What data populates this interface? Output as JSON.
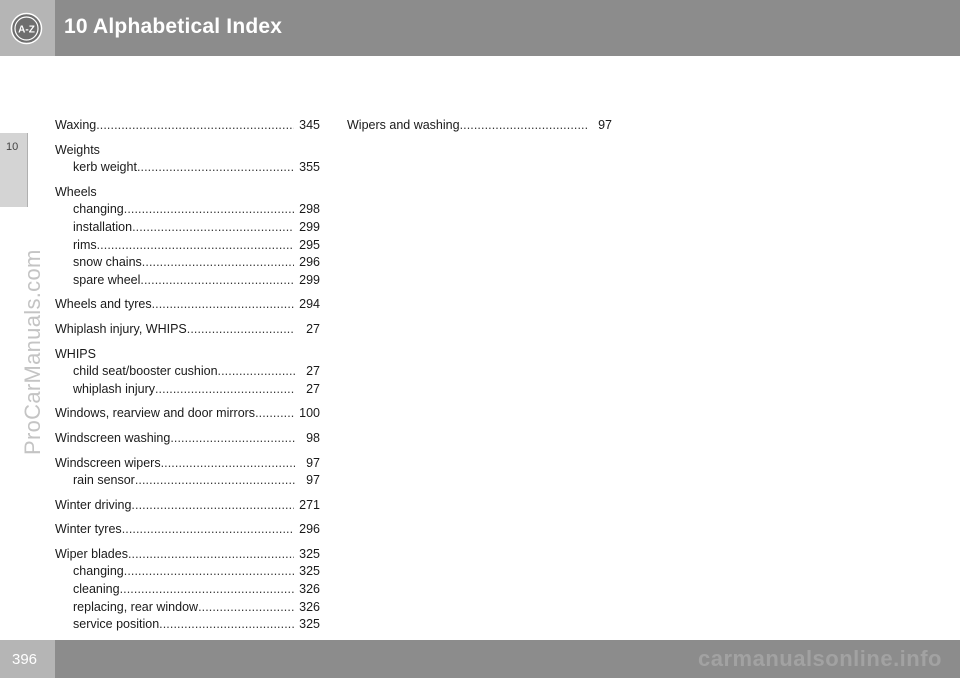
{
  "header": {
    "icon_label": "A-Z",
    "title": "10 Alphabetical Index"
  },
  "chapter_tab": "10",
  "side_watermark": "ProCarManuals.com",
  "footer": {
    "page_number": "396",
    "watermark": "carmanualsonline.info"
  },
  "index": {
    "left": [
      {
        "term": "Waxing",
        "page": "345",
        "subs": []
      },
      {
        "term": "Weights",
        "page": "",
        "subs": [
          {
            "term": "kerb weight",
            "page": "355"
          }
        ]
      },
      {
        "term": "Wheels",
        "page": "",
        "subs": [
          {
            "term": "changing",
            "page": "298"
          },
          {
            "term": "installation",
            "page": "299"
          },
          {
            "term": "rims",
            "page": "295"
          },
          {
            "term": "snow chains",
            "page": "296"
          },
          {
            "term": "spare wheel",
            "page": "299"
          }
        ]
      },
      {
        "term": "Wheels and tyres",
        "page": "294",
        "subs": []
      },
      {
        "term": "Whiplash injury, WHIPS",
        "page": "27",
        "subs": []
      },
      {
        "term": "WHIPS",
        "page": "",
        "subs": [
          {
            "term": "child seat/booster cushion",
            "page": "27"
          },
          {
            "term": "whiplash injury",
            "page": "27"
          }
        ]
      },
      {
        "term": "Windows, rearview and door mirrors",
        "page": "100",
        "subs": []
      },
      {
        "term": "Windscreen washing",
        "page": "98",
        "subs": []
      },
      {
        "term": "Windscreen wipers",
        "page": "97",
        "subs": [
          {
            "term": "rain sensor",
            "page": "97"
          }
        ]
      },
      {
        "term": "Winter driving",
        "page": "271",
        "subs": []
      },
      {
        "term": "Winter tyres",
        "page": "296",
        "subs": []
      },
      {
        "term": "Wiper blades",
        "page": "325",
        "subs": [
          {
            "term": "changing",
            "page": "325"
          },
          {
            "term": "cleaning",
            "page": "326"
          },
          {
            "term": "replacing, rear window",
            "page": "326"
          },
          {
            "term": "service position",
            "page": "325"
          }
        ]
      }
    ],
    "right": [
      {
        "term": "Wipers and washing",
        "page": "97",
        "subs": []
      }
    ]
  }
}
